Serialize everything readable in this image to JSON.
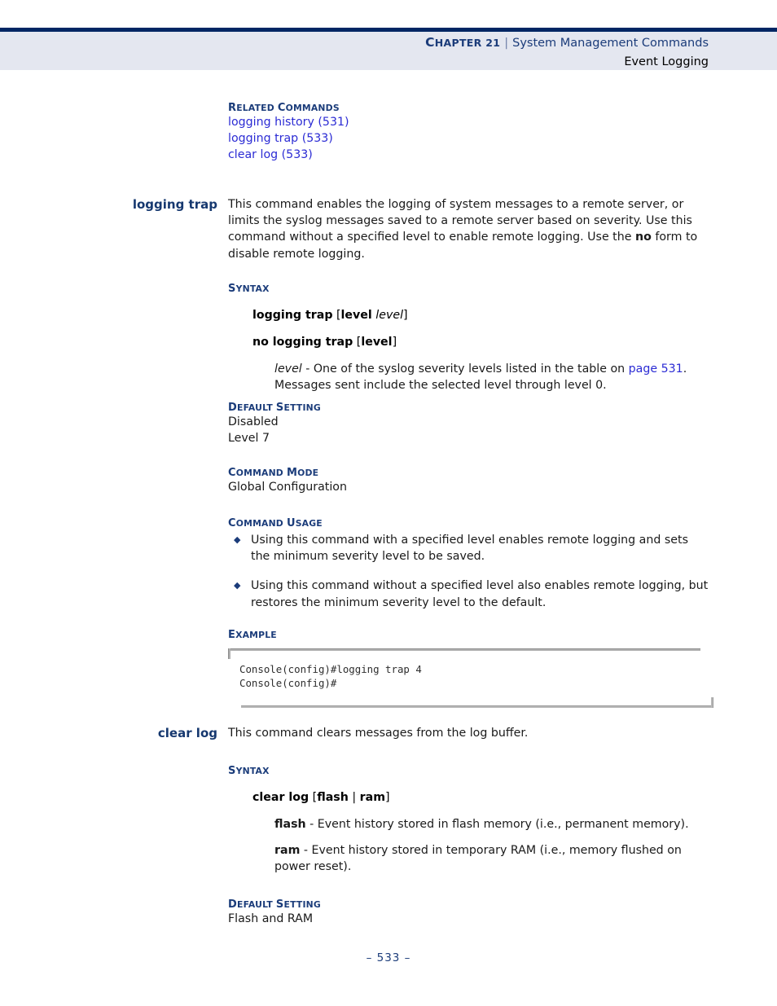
{
  "header": {
    "chapter_label_first": "C",
    "chapter_label_rest": "HAPTER 21",
    "separator": "|",
    "title": "System Management Commands",
    "subtitle": "Event Logging"
  },
  "related_commands": {
    "heading_first": "R",
    "heading_rest": "ELATED ",
    "heading_first2": "C",
    "heading_rest2": "OMMANDS",
    "links": [
      "logging history (531)",
      "logging trap (533)",
      "clear log (533)"
    ]
  },
  "logging_trap": {
    "gutter_label": "logging trap",
    "description_part1": "This command enables the logging of system messages to a remote server, or limits the syslog messages saved to a remote server based on severity. Use this command without a specified level to enable remote logging. Use the ",
    "description_bold": "no",
    "description_part2": " form to disable remote logging.",
    "syntax_heading_first": "S",
    "syntax_heading_rest": "YNTAX",
    "syntax_line1_bold": "logging trap",
    "syntax_line1_bracket_open": " [",
    "syntax_line1_keyword": "level",
    "syntax_line1_italic": " level",
    "syntax_line1_bracket_close": "]",
    "syntax_line2_bold": "no logging trap",
    "syntax_line2_bracket_open": " [",
    "syntax_line2_keyword": "level",
    "syntax_line2_bracket_close": "]",
    "param_italic": "level",
    "param_text1": " - One of the syslog severity levels listed in the table on ",
    "param_link": "page 531",
    "param_text2": ". Messages sent include the selected level through level 0.",
    "default_heading_first": "D",
    "default_heading_rest": "EFAULT ",
    "default_heading_first2": "S",
    "default_heading_rest2": "ETTING",
    "default_line1": "Disabled",
    "default_line2": "Level 7",
    "mode_heading_first": "C",
    "mode_heading_rest": "OMMAND ",
    "mode_heading_first2": "M",
    "mode_heading_rest2": "ODE",
    "mode_value": "Global Configuration",
    "usage_heading_first": "C",
    "usage_heading_rest": "OMMAND ",
    "usage_heading_first2": "U",
    "usage_heading_rest2": "SAGE",
    "usage_bullets": [
      "Using this command with a specified level enables remote logging and sets the minimum severity level to be saved.",
      "Using this command without a specified level also enables remote logging, but restores the minimum severity level to the default."
    ],
    "bullet_marker": "◆",
    "example_heading_first": "E",
    "example_heading_rest": "XAMPLE",
    "example_code": "Console(config)#logging trap 4\nConsole(config)#"
  },
  "clear_log": {
    "gutter_label": "clear log",
    "description": "This command clears messages from the log buffer.",
    "syntax_heading_first": "S",
    "syntax_heading_rest": "YNTAX",
    "syntax_bold": "clear log",
    "syntax_bracket_open": " [",
    "syntax_opt1": "flash",
    "syntax_pipe": " | ",
    "syntax_opt2": "ram",
    "syntax_bracket_close": "]",
    "param_flash_bold": "flash",
    "param_flash_text": " - Event history stored in flash memory (i.e., permanent memory).",
    "param_ram_bold": "ram",
    "param_ram_text": " - Event history stored in temporary RAM (i.e., memory flushed on power reset).",
    "default_heading_first": "D",
    "default_heading_rest": "EFAULT ",
    "default_heading_first2": "S",
    "default_heading_rest2": "ETTING",
    "default_value": "Flash and RAM"
  },
  "footer": {
    "page_number": "–  533  –"
  }
}
